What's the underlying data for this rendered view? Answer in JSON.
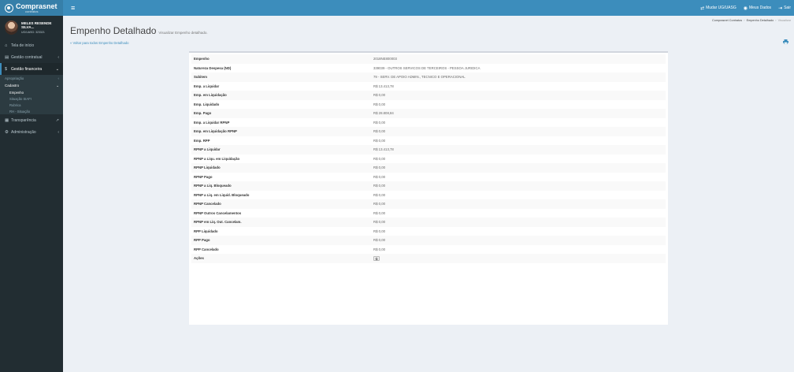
{
  "header": {
    "brand": "Comprasnet",
    "brand_sub": "contratos",
    "menu_toggle": "≡",
    "links": [
      {
        "icon": "⇄",
        "label": "Mudar UG/UASG"
      },
      {
        "icon": "◉",
        "label": "Meus Dados"
      },
      {
        "icon": "⇥",
        "label": "Sair"
      }
    ]
  },
  "sidebar": {
    "user_name": "MELES RESENDE SILVA...",
    "user_unit": "UG/UASG: 323321",
    "items": [
      {
        "icon": "⌂",
        "label": "Tela de início",
        "chevron": ""
      },
      {
        "icon": "▤",
        "label": "Gestão contratual",
        "chevron": "‹"
      },
      {
        "icon": "$",
        "label": "Gestão financeira",
        "chevron": "⌄"
      }
    ],
    "submenu": [
      {
        "label": "Apropriação",
        "chevron": "‹"
      },
      {
        "label": "Cadastro",
        "chevron": "⌄"
      }
    ],
    "cadastro_items": [
      "Empenho",
      "Situação SIAFI",
      "Rubrica",
      "RH - Situação"
    ],
    "items_after": [
      {
        "icon": "▦",
        "label": "Transparência",
        "chevron": "↗"
      },
      {
        "icon": "⚙",
        "label": "Administração",
        "chevron": "‹"
      }
    ]
  },
  "page": {
    "title": "Empenho Detalhado",
    "subtitle": "Visualizar Empenho detalhado.",
    "back_link": "« Voltar para todos Empenho Detalhado",
    "breadcrumb": [
      "Comprasnet Contratos",
      "Empenho Detalhado",
      "Visualizar"
    ]
  },
  "details": [
    {
      "label": "Empenho",
      "value": "2018NE800003"
    },
    {
      "label": "Natureza Despesa (ND)",
      "value": "339039 - OUTROS SERVICOS DE TERCEIROS - PESSOA JURIDICA"
    },
    {
      "label": "Subitem",
      "value": "79 - SERV. DE APOIO ADMIN., TECNICO E OPERACIONAL"
    },
    {
      "label": "Emp. a Liquidar",
      "value": "R$ 13.413,78"
    },
    {
      "label": "Emp. em Liquidação",
      "value": "R$ 0,00"
    },
    {
      "label": "Emp. Liquidado",
      "value": "R$ 0,00"
    },
    {
      "label": "Emp. Pago",
      "value": "R$ 28.808,84"
    },
    {
      "label": "Emp. a Liquidar RPNP",
      "value": "R$ 0,00"
    },
    {
      "label": "Emp. em Liquidação RPNP",
      "value": "R$ 0,00"
    },
    {
      "label": "Emp. RPP",
      "value": "R$ 0,00"
    },
    {
      "label": "RPNP a Liquidar",
      "value": "R$ 13.413,78"
    },
    {
      "label": "RPNP a Liqu. em Liquidação",
      "value": "R$ 0,00"
    },
    {
      "label": "RPNP Liquidado",
      "value": "R$ 0,00"
    },
    {
      "label": "RPNP Pago",
      "value": "R$ 0,00"
    },
    {
      "label": "RPNP a Liq. Bloqueado",
      "value": "R$ 0,00"
    },
    {
      "label": "RPNP a Liq. em Liquid. Bloqueado",
      "value": "R$ 0,00"
    },
    {
      "label": "RPNP Cancelado",
      "value": "R$ 0,00"
    },
    {
      "label": "RPNP Outros Cancelamentos",
      "value": "R$ 0,00"
    },
    {
      "label": "RPNP em Liq. Out. Cancelam.",
      "value": "R$ 0,00"
    },
    {
      "label": "RPP Liquidado",
      "value": "R$ 0,00"
    },
    {
      "label": "RPP Pago",
      "value": "R$ 0,00"
    },
    {
      "label": "RPP Cancelado",
      "value": "R$ 0,00"
    }
  ],
  "actions": {
    "label": "Ações",
    "button": "⧉"
  },
  "colors": {
    "header": "#3c8dbc",
    "logo_bg": "#367fa9",
    "sidebar": "#222d32",
    "content_bg": "#ecf0f5"
  }
}
